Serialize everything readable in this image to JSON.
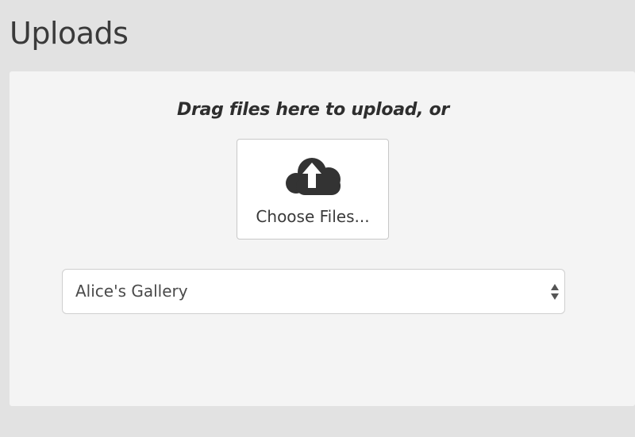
{
  "page": {
    "title": "Uploads"
  },
  "upload": {
    "drag_text": "Drag files here to upload, or",
    "choose_button_label": "Choose Files...",
    "button_icon": "cloud-upload-icon"
  },
  "gallery_select": {
    "selected_value": "Alice's Gallery",
    "arrow_icon": "select-updown-arrows-icon"
  },
  "colors": {
    "page_background": "#e2e2e2",
    "panel_background": "#f4f4f4",
    "icon_color": "#333333",
    "text_color": "#3a3a3a"
  }
}
